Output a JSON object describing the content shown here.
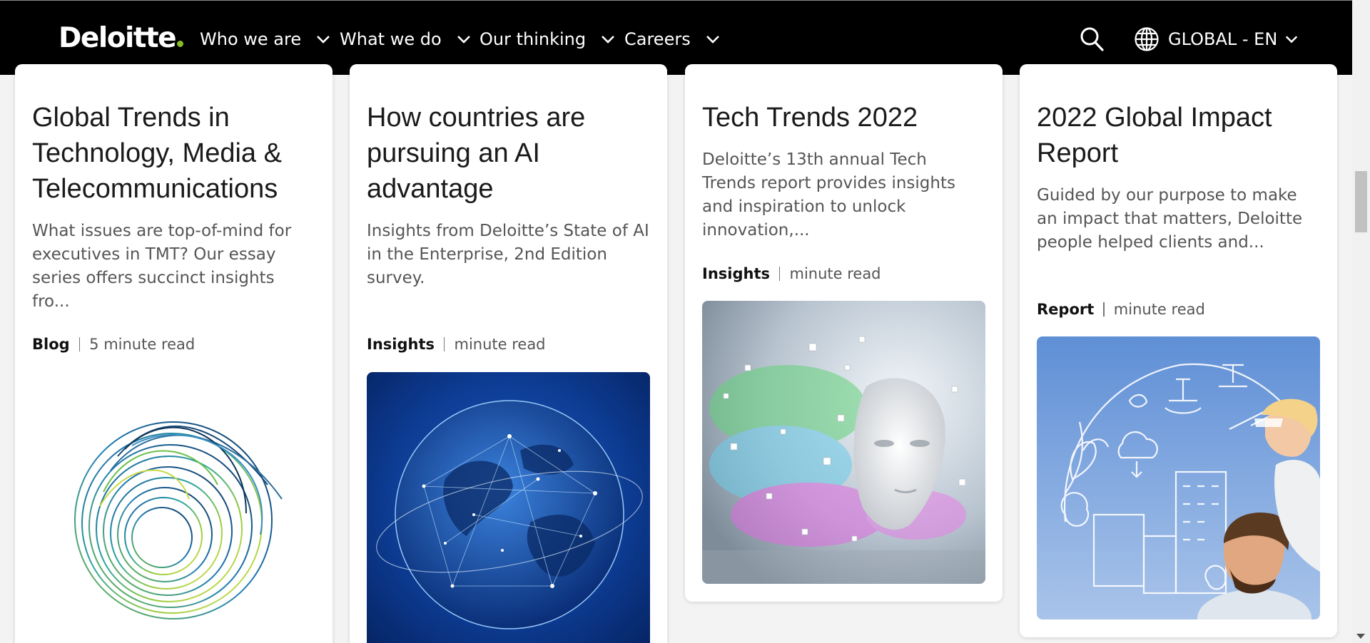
{
  "header": {
    "logo": "Deloitte",
    "nav": [
      {
        "label": "Who we are"
      },
      {
        "label": "What we do"
      },
      {
        "label": "Our thinking"
      },
      {
        "label": "Careers"
      }
    ],
    "locale": "GLOBAL - EN"
  },
  "cards": [
    {
      "title": "Global Trends in Technology, Media & Telecommunications",
      "description": "What issues are top-of-mind for executives in TMT? Our essay series offers succinct insights fro...",
      "type": "Blog",
      "read_time": "5 minute read",
      "image": "abstract-spiral-lines"
    },
    {
      "title": "How countries are pursuing an AI advantage",
      "description": "Insights from Deloitte’s State of AI in the Enterprise, 2nd Edition survey.",
      "type": "Insights",
      "read_time": "minute read",
      "image": "digital-globe-network"
    },
    {
      "title": "Tech Trends 2022",
      "description": "Deloitte’s 13th annual Tech Trends report provides insights and inspiration to unlock innovation,...",
      "type": "Insights",
      "read_time": "minute read",
      "image": "digital-face-cubes"
    },
    {
      "title": "2022 Global Impact Report",
      "description": "Guided by our purpose to make an impact that matters, Deloitte people helped clients and...",
      "type": "Report",
      "read_time": "minute read",
      "image": "father-child-sustainability-sketch"
    }
  ],
  "colors": {
    "header_bg": "#000000",
    "brand_green": "#86bc25",
    "page_bg": "#f3f3f3"
  }
}
